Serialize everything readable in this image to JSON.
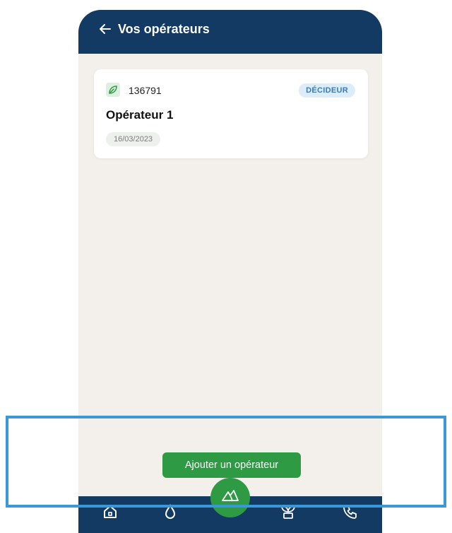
{
  "header": {
    "back_icon": "arrow-left-icon",
    "title": "Vos opérateurs"
  },
  "operator_card": {
    "icon": "leaf-icon",
    "code": "136791",
    "role_badge": "DÉCIDEUR",
    "name": "Opérateur 1",
    "date": "16/03/2023"
  },
  "actions": {
    "add_operator_label": "Ajouter un opérateur"
  },
  "bottom_nav": {
    "items": [
      {
        "icon": "home-icon"
      },
      {
        "icon": "water-drop-icon"
      },
      {
        "icon": "field-icon",
        "active": true
      },
      {
        "icon": "plant-icon"
      },
      {
        "icon": "phone-icon"
      }
    ]
  },
  "colors": {
    "header_bg": "#123a63",
    "accent_green": "#2f9a44",
    "badge_bg": "#dcecf9",
    "badge_text": "#3a7ab6",
    "page_bg": "#f3f0eb",
    "highlight": "#3a97d8"
  }
}
